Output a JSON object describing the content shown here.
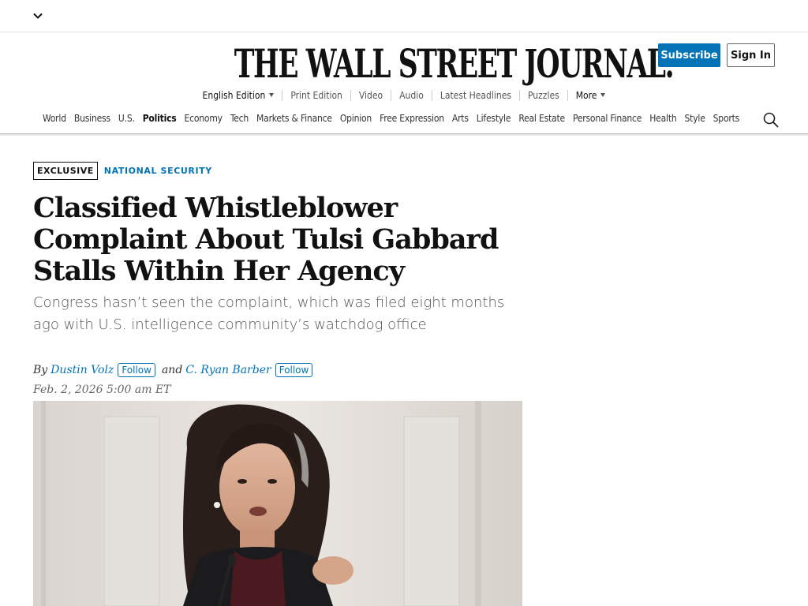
{
  "top_bar": {
    "menu_icon": "chevron-down-icon"
  },
  "masthead": {
    "logo": "THE WALL STREET JOURNAL.",
    "subscribe_label": "Subscribe",
    "signin_label": "Sign In",
    "edition_links": [
      "English Edition",
      "Print Edition",
      "Video",
      "Audio",
      "Latest Headlines",
      "Puzzles",
      "More"
    ]
  },
  "nav": {
    "sections": [
      "World",
      "Business",
      "U.S.",
      "Politics",
      "Economy",
      "Tech",
      "Markets & Finance",
      "Opinion",
      "Free Expression",
      "Arts",
      "Lifestyle",
      "Real Estate",
      "Personal Finance",
      "Health",
      "Style",
      "Sports"
    ],
    "active_section": "Politics",
    "search_icon": "search-icon"
  },
  "article": {
    "badge": "EXCLUSIVE",
    "section": "NATIONAL SECURITY",
    "headline": "Classified Whistleblower Complaint About Tulsi Gabbard Stalls Within Her Agency",
    "dek": "Congress hasn’t seen the complaint, which was filed eight months ago with U.S. intelligence community’s watchdog office",
    "byline_prefix": "By",
    "byline_and": "and",
    "authors": [
      "Dustin Volz",
      "C. Ryan Barber"
    ],
    "follow_label": "Follow",
    "timestamp": "Feb. 2, 2026 5:00 am ET"
  },
  "colors": {
    "accent": "#0274b6",
    "text": "#111111",
    "muted": "#555555"
  }
}
